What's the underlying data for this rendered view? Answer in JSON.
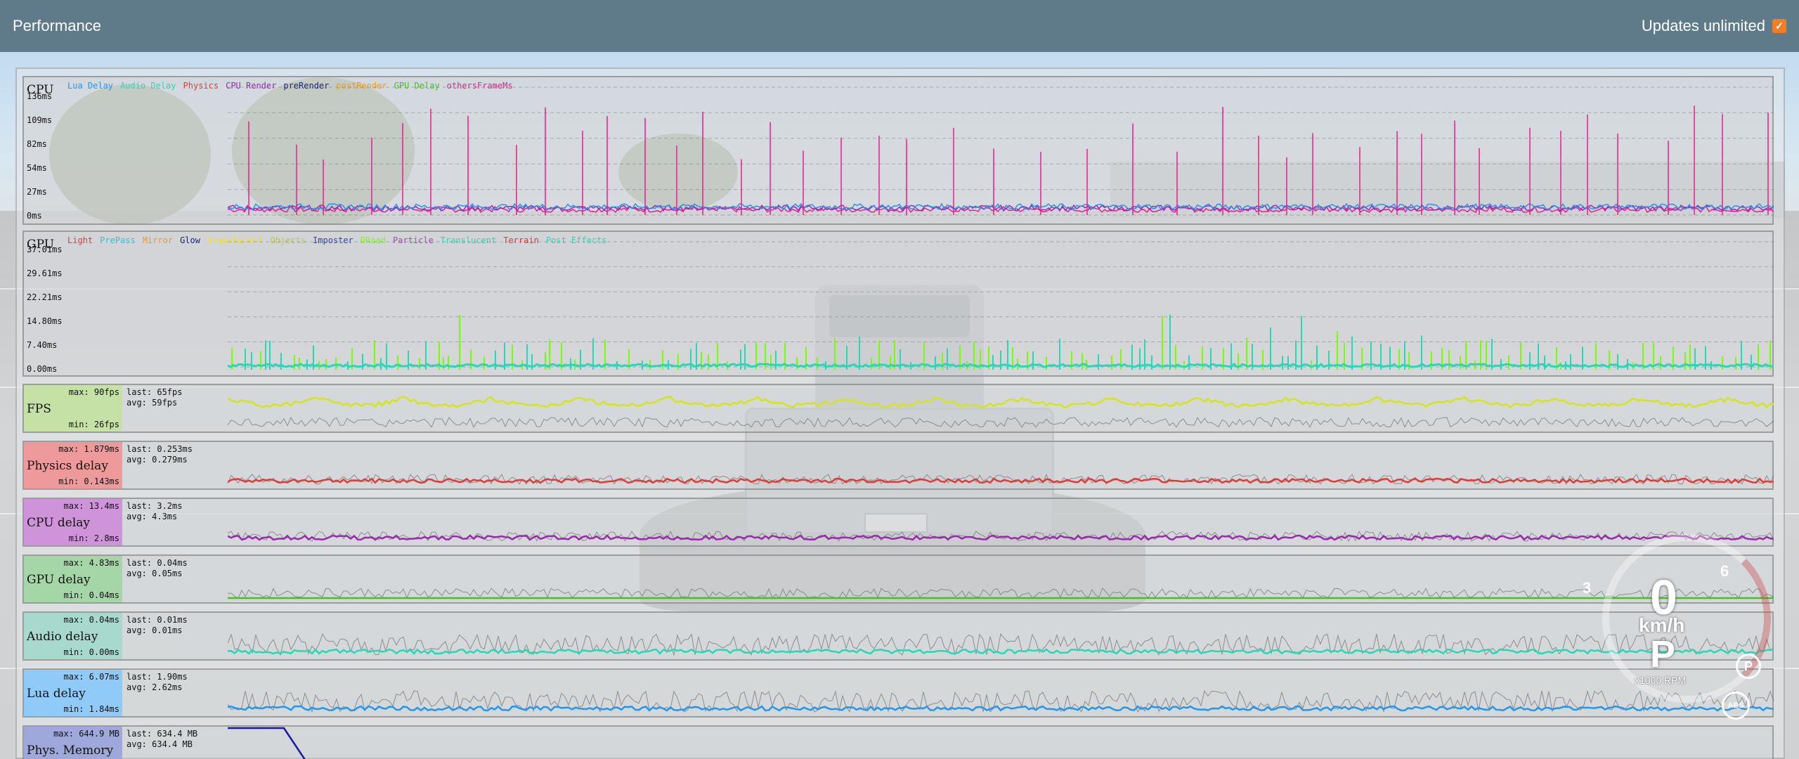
{
  "header": {
    "title": "Performance",
    "updates_label": "Updates unlimited",
    "updates_checked": true,
    "accent": "#f27d23",
    "bar_color": "#5f7b8a"
  },
  "cpu_graph": {
    "title": "CPU",
    "y_ticks": [
      "136ms",
      "109ms",
      "82ms",
      "54ms",
      "27ms",
      "0ms"
    ],
    "legend": [
      {
        "label": "Lua Delay",
        "color": "#2196f3"
      },
      {
        "label": "Audio Delay",
        "color": "#26d9b5"
      },
      {
        "label": "Physics",
        "color": "#e53935"
      },
      {
        "label": "CPU Render",
        "color": "#9c27b0"
      },
      {
        "label": "preRender",
        "color": "#1a237e"
      },
      {
        "label": "postRender",
        "color": "#ff9800"
      },
      {
        "label": "GPU Delay",
        "color": "#43c321"
      },
      {
        "label": "othersFrameMs",
        "color": "#e91e8c"
      }
    ]
  },
  "gpu_graph": {
    "title": "GPU",
    "y_ticks": [
      "37.01ms",
      "29.61ms",
      "22.21ms",
      "14.80ms",
      "7.40ms",
      "0.00ms"
    ],
    "legend": [
      {
        "label": "Light",
        "color": "#e53935"
      },
      {
        "label": "PrePass",
        "color": "#26c6da"
      },
      {
        "label": "Mirror",
        "color": "#ff9800"
      },
      {
        "label": "Glow",
        "color": "#1a237e"
      },
      {
        "label": "Translucent",
        "color": "#f2e600"
      },
      {
        "label": "Objects",
        "color": "#c0ca33"
      },
      {
        "label": "Imposter",
        "color": "#3949ab"
      },
      {
        "label": "DRoad",
        "color": "#76ff03"
      },
      {
        "label": "Particle",
        "color": "#ab47bc"
      },
      {
        "label": "Translucent",
        "color": "#26d9b5"
      },
      {
        "label": "Terrain",
        "color": "#e53935"
      },
      {
        "label": "Post Effects",
        "color": "#26d9b5"
      }
    ]
  },
  "small_graphs": [
    {
      "name": "FPS",
      "max": "max: 90fps",
      "min": "min: 26fps",
      "last": "last: 65fps",
      "avg": "avg: 59fps",
      "color": "#d4e61a",
      "box": "#c5e1a5"
    },
    {
      "name": "Physics delay",
      "max": "max: 1.879ms",
      "min": "min: 0.143ms",
      "last": "last: 0.253ms",
      "avg": "avg: 0.279ms",
      "color": "#e53935",
      "box": "#ef9a9a"
    },
    {
      "name": "CPU delay",
      "max": "max: 13.4ms",
      "min": "min: 2.8ms",
      "last": "last: 3.2ms",
      "avg": "avg: 4.3ms",
      "color": "#9c27b0",
      "box": "#ce93d8"
    },
    {
      "name": "GPU delay",
      "max": "max: 4.83ms",
      "min": "min: 0.04ms",
      "last": "last: 0.04ms",
      "avg": "avg: 0.05ms",
      "color": "#43c321",
      "box": "#a5d6a7"
    },
    {
      "name": "Audio delay",
      "max": "max: 0.04ms",
      "min": "min: 0.00ms",
      "last": "last: 0.01ms",
      "avg": "avg: 0.01ms",
      "color": "#26d9b5",
      "box": "#a7d9cf"
    },
    {
      "name": "Lua delay",
      "max": "max: 6.07ms",
      "min": "min: 1.84ms",
      "last": "last: 1.90ms",
      "avg": "avg: 2.62ms",
      "color": "#2196f3",
      "box": "#90caf9"
    },
    {
      "name": "Phys. Memory",
      "max": "max: 644.9 MB",
      "min": "",
      "last": "last: 634.4 MB",
      "avg": "avg: 634.4 MB",
      "color": "#1a1aa8",
      "box": "#9fa8da"
    }
  ],
  "hud": {
    "speed": "0",
    "unit": "km/h",
    "gear": "P",
    "rpm_label": "x1000 RPM",
    "tick_low": "3",
    "tick_high": "6",
    "park_icon": "parking-brake-icon",
    "abs_icon": "abs-icon"
  }
}
